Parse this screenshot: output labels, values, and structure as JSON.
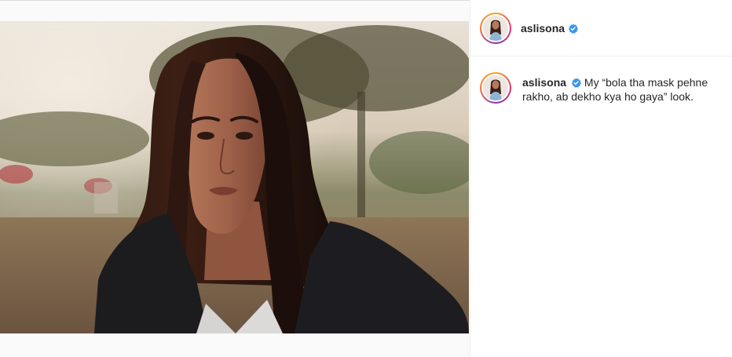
{
  "post": {
    "image_alt": "Portrait of a woman with long dark hair in a black jacket, outdoors at sunset"
  },
  "header": {
    "username": "aslisona",
    "verified": true
  },
  "caption": {
    "username": "aslisona",
    "verified": true,
    "text": "My “bola tha mask pehne rakho, ab dekho kya ho gaya” look."
  },
  "colors": {
    "verified_badge": "#3897f0",
    "text": "#262626",
    "border": "#efefef"
  },
  "icons": {
    "verified": "verified-badge-icon"
  }
}
